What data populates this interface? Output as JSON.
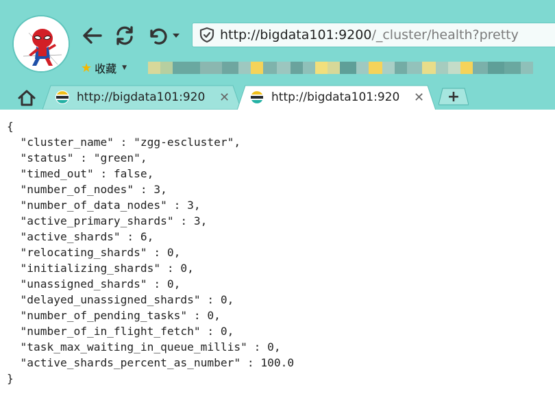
{
  "browser": {
    "address_host": "http://bigdata101:9200",
    "address_path": "/_cluster/health?pretty",
    "bookmarks_label": "收藏",
    "tabs": [
      {
        "title": "http://bigdata101:920"
      },
      {
        "title": "http://bigdata101:920"
      }
    ],
    "icons": {
      "back": "back-arrow-icon",
      "reload": "reload-icon",
      "undo": "undo-icon",
      "dropdown": "chevron-down-icon",
      "shield": "shield-icon",
      "star": "star-icon",
      "home": "home-icon",
      "close": "close-icon",
      "new_tab": "plus-icon"
    },
    "colors": {
      "chrome": "#7fd9d1",
      "accent": "#3ab0a6"
    }
  },
  "page": {
    "lines": [
      "{",
      "  \"cluster_name\" : \"zgg-escluster\",",
      "  \"status\" : \"green\",",
      "  \"timed_out\" : false,",
      "  \"number_of_nodes\" : 3,",
      "  \"number_of_data_nodes\" : 3,",
      "  \"active_primary_shards\" : 3,",
      "  \"active_shards\" : 6,",
      "  \"relocating_shards\" : 0,",
      "  \"initializing_shards\" : 0,",
      "  \"unassigned_shards\" : 0,",
      "  \"delayed_unassigned_shards\" : 0,",
      "  \"number_of_pending_tasks\" : 0,",
      "  \"number_of_in_flight_fetch\" : 0,",
      "  \"task_max_waiting_in_queue_millis\" : 0,",
      "  \"active_shards_percent_as_number\" : 100.0",
      "}"
    ]
  }
}
